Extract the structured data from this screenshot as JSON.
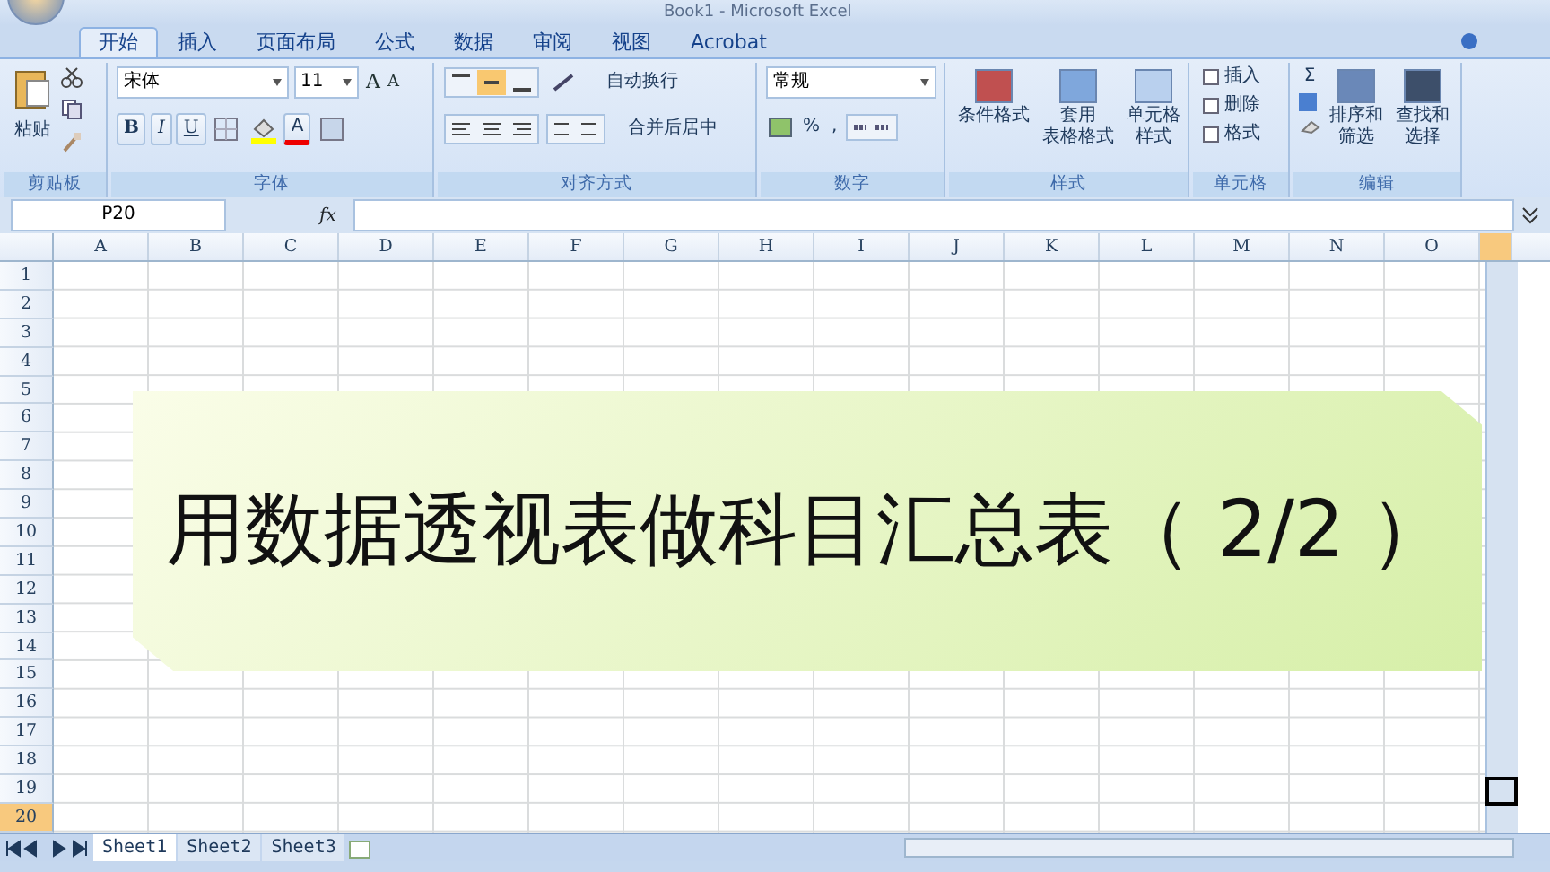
{
  "window": {
    "title": "Book1 - Microsoft Excel"
  },
  "tabs": [
    {
      "label": "开始",
      "selected": true
    },
    {
      "label": "插入",
      "selected": false
    },
    {
      "label": "页面布局",
      "selected": false
    },
    {
      "label": "公式",
      "selected": false
    },
    {
      "label": "数据",
      "selected": false
    },
    {
      "label": "审阅",
      "selected": false
    },
    {
      "label": "视图",
      "selected": false
    },
    {
      "label": "Acrobat",
      "selected": false
    }
  ],
  "ribbon": {
    "clipboard": {
      "label": "剪贴板",
      "paste": "粘贴"
    },
    "font": {
      "label": "字体",
      "font_name": "宋体",
      "font_size": "11",
      "grow": "A",
      "shrink": "A",
      "bold": "B",
      "italic": "I",
      "underline": "U",
      "font_color": "A"
    },
    "alignment": {
      "label": "对齐方式",
      "wrap_text": "自动换行",
      "merge_center": "合并后居中"
    },
    "number": {
      "label": "数字",
      "format": "常规",
      "percent": "%",
      "comma": ","
    },
    "styles": {
      "label": "样式",
      "buttons": [
        [
          "条件格式"
        ],
        [
          "套用",
          "表格格式"
        ],
        [
          "单元格",
          "样式"
        ]
      ]
    },
    "cells": {
      "label": "单元格",
      "buttons": [
        "插入",
        "删除",
        "格式"
      ]
    },
    "editing": {
      "label": "编辑",
      "sum": "Σ",
      "buttons": [
        [
          "排序和",
          "筛选"
        ],
        [
          "查找和",
          "选择"
        ]
      ]
    }
  },
  "formula_bar": {
    "name_box": "P20",
    "function_label": "fx"
  },
  "sheet": {
    "columns": [
      {
        "label": "A",
        "selected": false
      },
      {
        "label": "B",
        "selected": false
      },
      {
        "label": "C",
        "selected": false
      },
      {
        "label": "D",
        "selected": false
      },
      {
        "label": "E",
        "selected": false
      },
      {
        "label": "F",
        "selected": false
      },
      {
        "label": "G",
        "selected": false
      },
      {
        "label": "H",
        "selected": false
      },
      {
        "label": "I",
        "selected": false
      },
      {
        "label": "J",
        "selected": false
      },
      {
        "label": "K",
        "selected": false
      },
      {
        "label": "L",
        "selected": false
      },
      {
        "label": "M",
        "selected": false
      },
      {
        "label": "N",
        "selected": false
      },
      {
        "label": "O",
        "selected": false
      }
    ],
    "partial_column": {
      "selected": true
    },
    "rows": [
      {
        "label": "1",
        "selected": false
      },
      {
        "label": "2",
        "selected": false
      },
      {
        "label": "3",
        "selected": false
      },
      {
        "label": "4",
        "selected": false
      },
      {
        "label": "5",
        "selected": false
      },
      {
        "label": "6",
        "selected": false
      },
      {
        "label": "7",
        "selected": false
      },
      {
        "label": "8",
        "selected": false
      },
      {
        "label": "9",
        "selected": false
      },
      {
        "label": "10",
        "selected": false
      },
      {
        "label": "11",
        "selected": false
      },
      {
        "label": "12",
        "selected": false
      },
      {
        "label": "13",
        "selected": false
      },
      {
        "label": "14",
        "selected": false
      },
      {
        "label": "15",
        "selected": false
      },
      {
        "label": "16",
        "selected": false
      },
      {
        "label": "17",
        "selected": false
      },
      {
        "label": "18",
        "selected": false
      },
      {
        "label": "19",
        "selected": false
      },
      {
        "label": "20",
        "selected": true
      }
    ]
  },
  "banner": {
    "text": "用数据透视表做科目汇总表（ 2/2 ）"
  },
  "sheet_tabs": [
    {
      "label": "Sheet1",
      "selected": true
    },
    {
      "label": "Sheet2",
      "selected": false
    },
    {
      "label": "Sheet3",
      "selected": false
    }
  ]
}
